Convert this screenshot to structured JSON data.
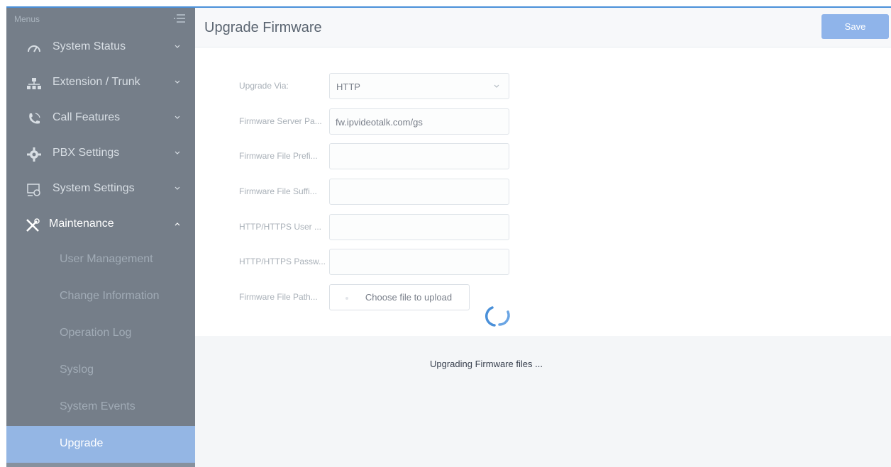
{
  "sidebar": {
    "header": "Menus",
    "items": [
      {
        "label": "System Status",
        "icon": "gauge-icon"
      },
      {
        "label": "Extension / Trunk",
        "icon": "network-icon"
      },
      {
        "label": "Call Features",
        "icon": "phone-icon"
      },
      {
        "label": "PBX Settings",
        "icon": "gear-icon"
      },
      {
        "label": "System Settings",
        "icon": "settings-screen-icon"
      },
      {
        "label": "Maintenance",
        "icon": "tools-icon"
      }
    ],
    "subitems": [
      {
        "label": "User Management"
      },
      {
        "label": "Change Information"
      },
      {
        "label": "Operation Log"
      },
      {
        "label": "Syslog"
      },
      {
        "label": "System Events"
      },
      {
        "label": "Upgrade"
      }
    ]
  },
  "header": {
    "title": "Upgrade Firmware",
    "save_label": "Save"
  },
  "form": {
    "upgrade_via": {
      "label": "Upgrade Via:",
      "value": "HTTP"
    },
    "server_path": {
      "label": "Firmware Server Pa...",
      "value": "fw.ipvideotalk.com/gs"
    },
    "file_prefix": {
      "label": "Firmware File Prefi...",
      "value": ""
    },
    "file_suffix": {
      "label": "Firmware File Suffi...",
      "value": ""
    },
    "http_user": {
      "label": "HTTP/HTTPS User ...",
      "value": ""
    },
    "http_pass": {
      "label": "HTTP/HTTPS Passw...",
      "value": ""
    },
    "file_path": {
      "label": "Firmware File Path...",
      "button": "Choose file to upload"
    }
  },
  "loading": {
    "message": "Upgrading Firmware files ..."
  },
  "colors": {
    "sidebar_bg": "#2b3a4a",
    "active_item": "#5b8fd6",
    "save_button": "#8fb4ea",
    "spinner": "#4a90d9"
  }
}
